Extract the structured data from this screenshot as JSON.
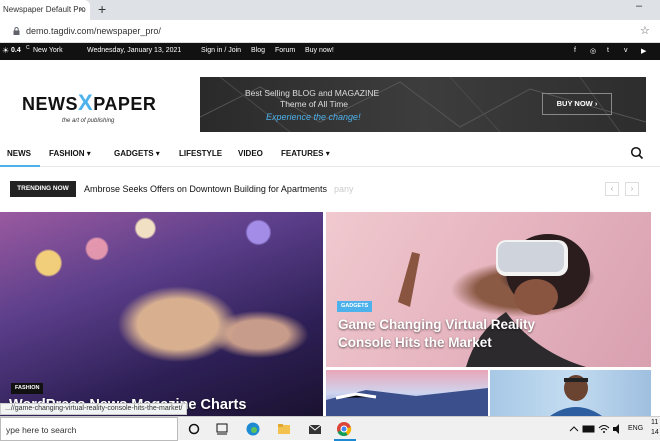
{
  "browser": {
    "tab_title": "Newspaper Default Pro",
    "tab_close": "×",
    "new_tab": "+",
    "min_btn": "–",
    "url": "demo.tagdiv.com/newspaper_pro/",
    "star": "☆"
  },
  "topbar": {
    "weather_temp": "0.4",
    "weather_unit": "C",
    "location": "New York",
    "date": "Wednesday, January 13, 2021",
    "links": [
      "Sign in / Join",
      "Blog",
      "Forum",
      "Buy now!"
    ],
    "social_icons": [
      "facebook-icon",
      "instagram-icon",
      "twitter-icon",
      "vimeo-icon",
      "youtube-icon"
    ],
    "social_glyphs": [
      "f",
      "◎",
      "t",
      "v",
      "▶"
    ]
  },
  "header": {
    "logo_left": "NEWS",
    "logo_x": "X",
    "logo_right": "PAPER",
    "logo_tagline": "the art of publishing",
    "banner_line1": "Best Selling BLOG and MAGAZINE",
    "banner_line2": "Theme of All Time",
    "banner_line3": "Experience the change!",
    "banner_button": "BUY NOW ›"
  },
  "nav": {
    "items": [
      "NEWS",
      "FASHION ▾",
      "GADGETS ▾",
      "LIFESTYLE",
      "VIDEO",
      "FEATURES ▾"
    ]
  },
  "trending": {
    "label": "TRENDING NOW",
    "headline": "Ambrose Seeks Offers on Downtown Building for Apartments",
    "ghost_text": "pany",
    "prev": "‹",
    "next": "›"
  },
  "articles": [
    {
      "category": "FASHION",
      "title": "WordPress News Magazine Charts"
    },
    {
      "category": "GADGETS",
      "title": "Game Changing Virtual Reality Console Hits the Market"
    }
  ],
  "status_url": "...//game-changing-virtual-reality-console-hits-the-market/",
  "taskbar": {
    "search_placeholder": "ype here to search",
    "language": "ENG",
    "time": "11",
    "date": "14"
  },
  "colors": {
    "accent": "#4db2ec",
    "topbar_bg": "#111111"
  }
}
